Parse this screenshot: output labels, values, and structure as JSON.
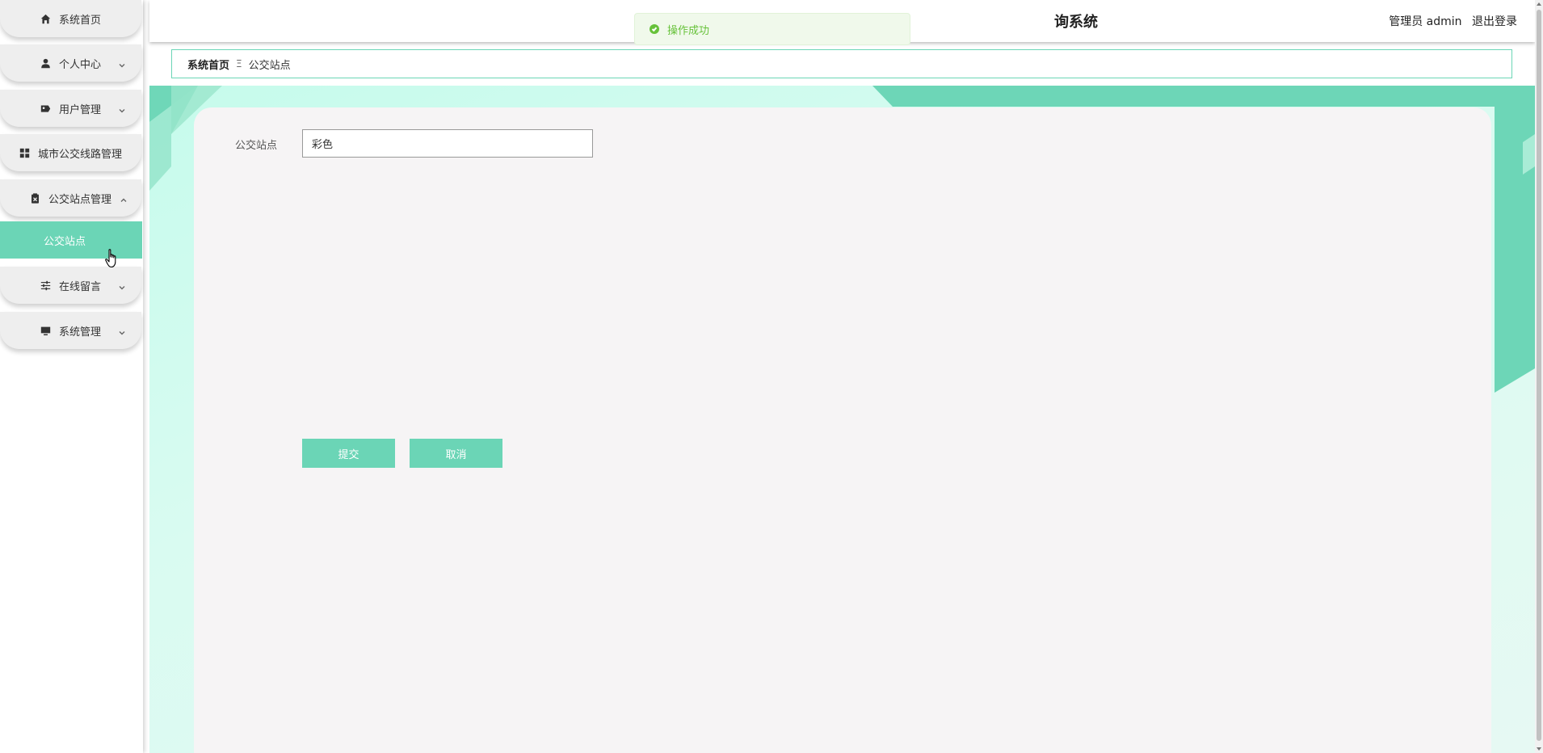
{
  "header": {
    "title": "询系统",
    "user_label": "管理员 admin",
    "logout_label": "退出登录"
  },
  "toast": {
    "message": "操作成功",
    "icon": "check-circle-icon"
  },
  "sidebar": {
    "items": [
      {
        "label": "系统首页",
        "icon": "home-icon",
        "expandable": false
      },
      {
        "label": "个人中心",
        "icon": "user-icon",
        "expandable": true
      },
      {
        "label": "用户管理",
        "icon": "id-card-icon",
        "expandable": true
      },
      {
        "label": "城市公交线路管理",
        "icon": "grid-icon",
        "expandable": false
      },
      {
        "label": "公交站点管理",
        "icon": "clipboard-icon",
        "expandable": true,
        "expanded": true
      },
      {
        "label": "在线留言",
        "icon": "sliders-icon",
        "expandable": true
      },
      {
        "label": "系统管理",
        "icon": "monitor-icon",
        "expandable": true
      }
    ],
    "active_sub_item": "公交站点"
  },
  "breadcrumb": {
    "home": "系统首页",
    "separator": "Ξ",
    "current": "公交站点"
  },
  "form": {
    "field_label": "公交站点",
    "field_value": "彩色",
    "submit_label": "提交",
    "cancel_label": "取消"
  },
  "colors": {
    "accent": "#6bd5b6",
    "panel": "#f6f4f5",
    "toast_bg": "#f0f9eb",
    "toast_text": "#67c23a"
  }
}
